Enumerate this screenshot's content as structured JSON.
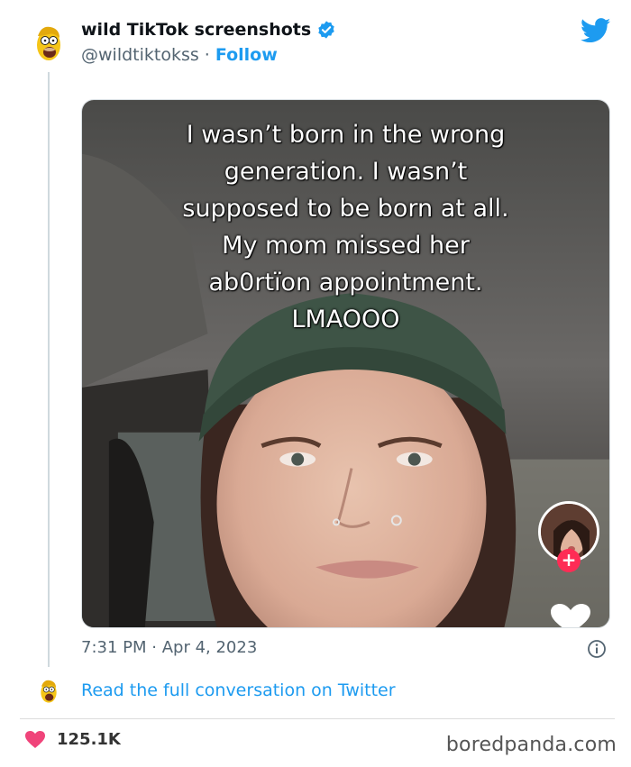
{
  "tweet": {
    "display_name": "wild TikTok screenshots",
    "handle": "@wildtiktokss",
    "separator": " · ",
    "follow_label": "Follow",
    "caption_lines": [
      "I wasn’t born in the wrong",
      "generation. I wasn’t",
      "supposed to be born at all.",
      "My mom missed her",
      "ab0rtïon appointment.",
      "LMAOOO"
    ],
    "time": "7:31 PM",
    "date": "Apr 4, 2023",
    "read_more": "Read the full conversation on Twitter"
  },
  "footer": {
    "likes": "125.1K",
    "brand": "boredpanda.com"
  },
  "colors": {
    "twitter_blue": "#1d9bf0",
    "like_pink": "#f0447a",
    "tiktok_red": "#fe2c55"
  },
  "icons": {
    "verified": "verified-badge-icon",
    "bird": "twitter-bird-icon",
    "info": "info-icon",
    "heart": "heart-icon",
    "plus": "plus-icon"
  },
  "tiktok": {
    "follow_plus": "+"
  }
}
